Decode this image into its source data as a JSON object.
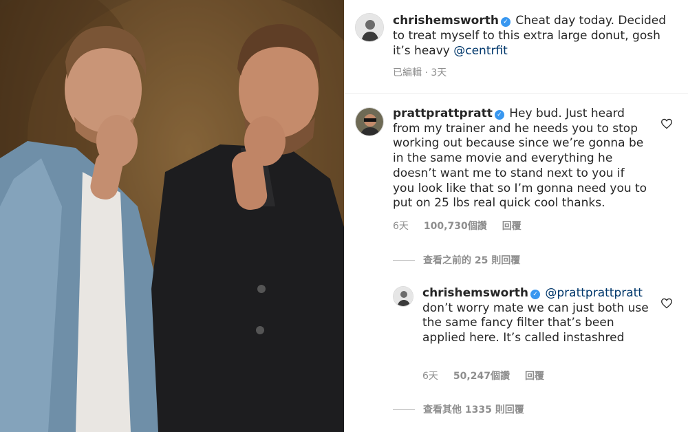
{
  "post": {
    "author": "chrishemsworth",
    "caption": "Cheat day today. Decided to treat myself to this extra large donut, gosh it’s heavy",
    "mention": "@centrfit",
    "edited_label": "已編輯",
    "separator": "·",
    "age": "3天"
  },
  "comments": [
    {
      "author": "prattprattpratt",
      "text": "Hey bud. Just heard from my trainer and he needs you to stop working out because since we’re gonna be in the same movie and everything he doesn’t want me to stand next to you if you look like that so I’m gonna need you to put on 25 lbs real quick cool thanks.",
      "age": "6天",
      "likes": "100,730個讚",
      "reply_label": "回覆"
    }
  ],
  "view_previous_replies": "查看之前的 25 則回覆",
  "reply": {
    "author": "chrishemsworth",
    "mention": "@prattprattpratt",
    "text": "don’t worry mate we can just both use the same fancy filter that’s been applied here. It’s called instashred",
    "age": "6天",
    "likes": "50,247個讚",
    "reply_label": "回覆"
  },
  "view_other_replies": "查看其他 1335 則回覆",
  "icons": {
    "verified": "verified-badge-icon",
    "like": "heart-icon"
  },
  "colors": {
    "verified_blue": "#3897f0",
    "mention": "#00376b",
    "secondary_text": "#8e8e8e"
  }
}
